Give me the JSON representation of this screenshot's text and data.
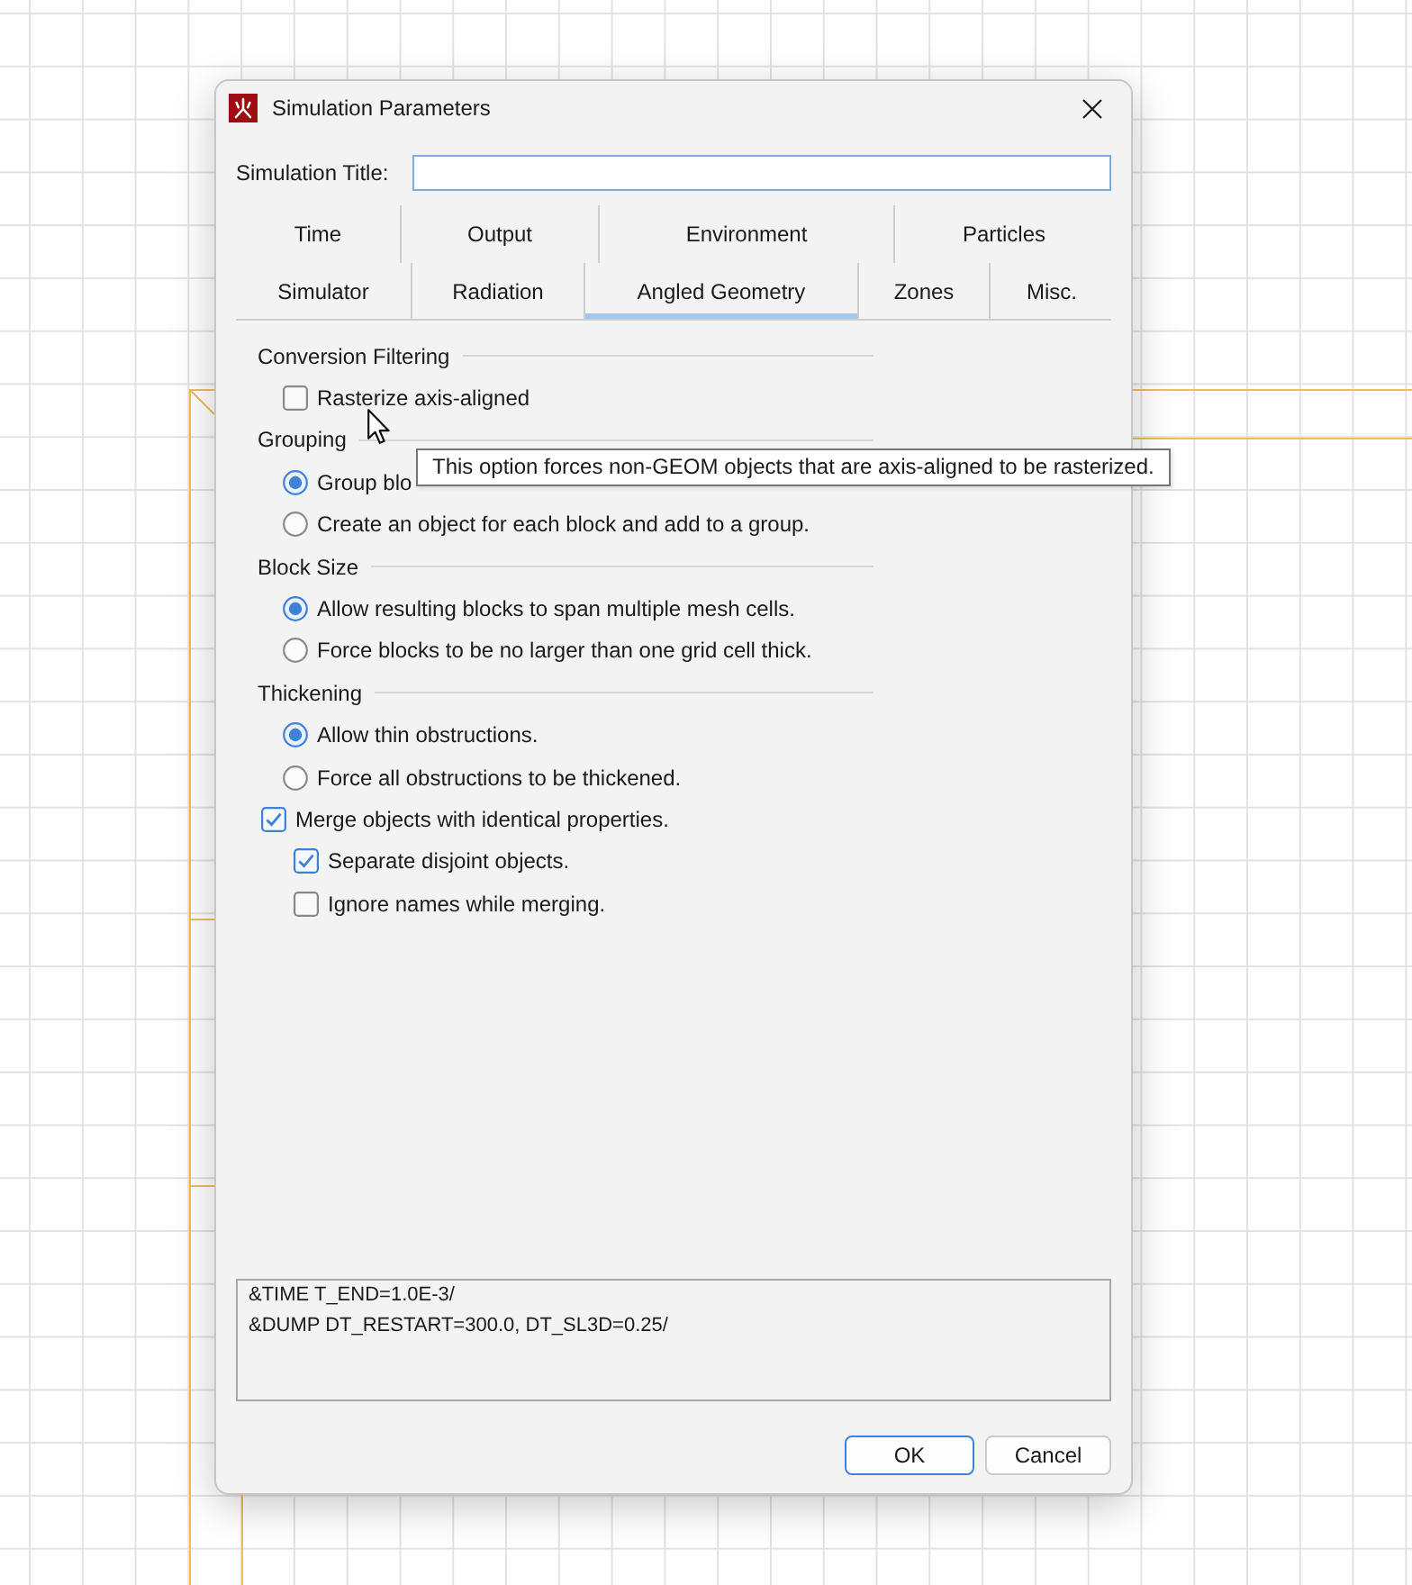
{
  "window": {
    "title": "Simulation Parameters"
  },
  "title_field": {
    "label": "Simulation Title:"
  },
  "tab_rows": [
    [
      {
        "label": "Time",
        "selected": false
      },
      {
        "label": "Output",
        "selected": false
      },
      {
        "label": "Environment",
        "selected": false
      },
      {
        "label": "Particles",
        "selected": false
      }
    ],
    [
      {
        "label": "Simulator",
        "selected": false
      },
      {
        "label": "Radiation",
        "selected": false
      },
      {
        "label": "Angled Geometry",
        "selected": true
      },
      {
        "label": "Zones",
        "selected": false
      },
      {
        "label": "Misc.",
        "selected": false
      }
    ]
  ],
  "sections": [
    {
      "heading": "Conversion Filtering",
      "options": [
        {
          "kind": "checkbox",
          "label": "Rasterize axis-aligned",
          "checked": false
        }
      ]
    },
    {
      "heading": "Grouping",
      "options": [
        {
          "kind": "radio",
          "label": "Group blo",
          "selected": true
        },
        {
          "kind": "radio",
          "label": "Create an object for each block and add to a group.",
          "selected": false
        }
      ]
    },
    {
      "heading": "Block Size",
      "options": [
        {
          "kind": "radio",
          "label": "Allow resulting blocks to span multiple mesh cells.",
          "selected": true
        },
        {
          "kind": "radio",
          "label": "Force blocks to be no larger than one grid cell thick.",
          "selected": false
        }
      ]
    },
    {
      "heading": "Thickening",
      "options": [
        {
          "kind": "radio",
          "label": "Allow thin obstructions.",
          "selected": true
        },
        {
          "kind": "radio",
          "label": "Force all obstructions to be thickened.",
          "selected": false
        }
      ]
    }
  ],
  "merge_options": [
    {
      "label": "Merge objects with identical properties.",
      "checked": true,
      "children": [
        {
          "label": "Separate disjoint objects.",
          "checked": true
        },
        {
          "label": "Ignore names while merging.",
          "checked": false
        }
      ]
    }
  ],
  "preview": {
    "lines": [
      "&TIME T_END=1.0E-3/",
      "&DUMP DT_RESTART=300.0, DT_SL3D=0.25/"
    ]
  },
  "buttons": [
    {
      "label": "OK",
      "default": true
    },
    {
      "label": "Cancel",
      "default": false
    }
  ],
  "tooltip": {
    "text": "This option forces non-GEOM objects that are axis-aligned to be rasterized."
  }
}
